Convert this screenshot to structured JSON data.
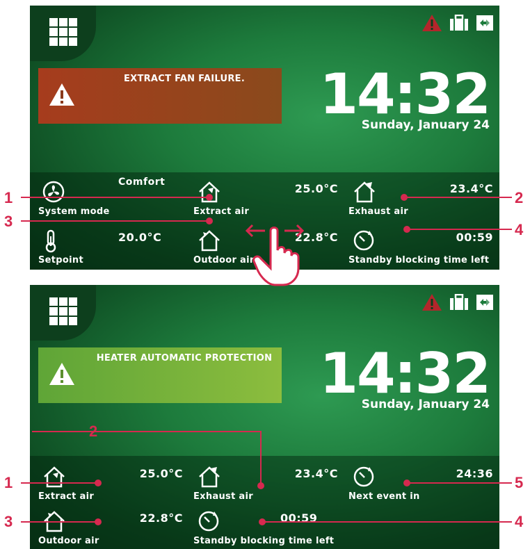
{
  "screens": [
    {
      "alarm_text": "EXTRACT FAN FAILURE.",
      "clock": {
        "time": "14:32",
        "date": "Sunday, January 24"
      },
      "tiles": [
        {
          "label": "System mode",
          "value": "Comfort",
          "icon": "fan-icon"
        },
        {
          "label": "Extract air",
          "value": "25.0°C",
          "icon": "house-extract-icon"
        },
        {
          "label": "Exhaust air",
          "value": "23.4°C",
          "icon": "house-exhaust-icon"
        },
        {
          "label": "Setpoint",
          "value": "20.0°C",
          "icon": "thermometer-icon"
        },
        {
          "label": "Outdoor air",
          "value": "22.8°C",
          "icon": "house-outdoor-icon"
        },
        {
          "label": "Standby blocking time left",
          "value": "00:59",
          "icon": "timer-icon"
        }
      ],
      "callouts": [
        "1",
        "2",
        "3",
        "4"
      ]
    },
    {
      "alarm_text": "HEATER AUTOMATIC PROTECTION",
      "clock": {
        "time": "14:32",
        "date": "Sunday, January 24"
      },
      "tiles": [
        {
          "label": "Extract air",
          "value": "25.0°C",
          "icon": "house-extract-icon"
        },
        {
          "label": "Exhaust air",
          "value": "23.4°C",
          "icon": "house-exhaust-icon"
        },
        {
          "label": "Next event in",
          "value": "24:36",
          "icon": "timer-icon"
        },
        {
          "label": "Outdoor air",
          "value": "22.8°C",
          "icon": "house-outdoor-icon"
        },
        {
          "label": "Standby blocking time left",
          "value": "00:59",
          "icon": "timer-icon"
        }
      ],
      "callouts": [
        "1",
        "2",
        "3",
        "4",
        "5"
      ]
    }
  ],
  "colors": {
    "callout": "#d6294f",
    "warning_red": "#b3262b",
    "screen_green": "#1d7b3c"
  }
}
